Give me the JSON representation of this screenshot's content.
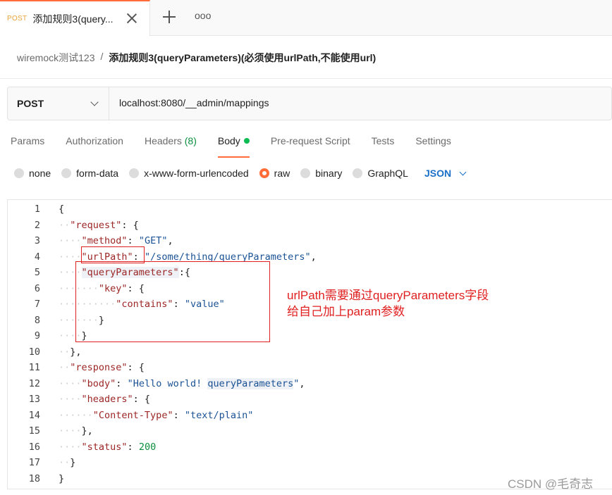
{
  "tab": {
    "method": "POST",
    "title": "添加规则3(query...",
    "more_label": "ooo"
  },
  "breadcrumb": {
    "parent": "wiremock测试123",
    "separator": "/",
    "current": "添加规则3(queryParameters)(必须使用urlPath,不能使用url)"
  },
  "request": {
    "method": "POST",
    "url": "localhost:8080/__admin/mappings"
  },
  "request_tabs": [
    {
      "label": "Params"
    },
    {
      "label": "Authorization"
    },
    {
      "label": "Headers",
      "count": "(8)"
    },
    {
      "label": "Body"
    },
    {
      "label": "Pre-request Script"
    },
    {
      "label": "Tests"
    },
    {
      "label": "Settings"
    }
  ],
  "body_types": [
    {
      "label": "none"
    },
    {
      "label": "form-data"
    },
    {
      "label": "x-www-form-urlencoded"
    },
    {
      "label": "raw",
      "selected": true
    },
    {
      "label": "binary"
    },
    {
      "label": "GraphQL"
    }
  ],
  "body_format": "JSON",
  "editor": {
    "line_numbers": [
      "1",
      "2",
      "3",
      "4",
      "5",
      "6",
      "7",
      "8",
      "9",
      "10",
      "11",
      "12",
      "13",
      "14",
      "15",
      "16",
      "17",
      "18"
    ],
    "lines": [
      {
        "ind": "",
        "parts": [
          {
            "t": "{",
            "c": "punc"
          }
        ]
      },
      {
        "ind": "··",
        "parts": [
          {
            "t": "\"request\"",
            "c": "key"
          },
          {
            "t": ": {",
            "c": "punc"
          }
        ]
      },
      {
        "ind": "····",
        "parts": [
          {
            "t": "\"method\"",
            "c": "key"
          },
          {
            "t": ": ",
            "c": "punc"
          },
          {
            "t": "\"GET\"",
            "c": "str"
          },
          {
            "t": ",",
            "c": "punc"
          }
        ]
      },
      {
        "ind": "····",
        "parts": [
          {
            "t": "\"urlPath\"",
            "c": "key"
          },
          {
            "t": ": ",
            "c": "punc"
          },
          {
            "t": "\"/some/thing/queryParameters\"",
            "c": "str"
          },
          {
            "t": ",",
            "c": "punc"
          }
        ]
      },
      {
        "ind": "····",
        "parts": [
          {
            "t": "\"queryParameters\"",
            "c": "key hl"
          },
          {
            "t": ":{",
            "c": "punc"
          }
        ]
      },
      {
        "ind": "·······",
        "parts": [
          {
            "t": "\"key\"",
            "c": "key"
          },
          {
            "t": ": {",
            "c": "punc"
          }
        ]
      },
      {
        "ind": "··········",
        "parts": [
          {
            "t": "\"contains\"",
            "c": "key"
          },
          {
            "t": ": ",
            "c": "punc"
          },
          {
            "t": "\"value\"",
            "c": "str"
          }
        ]
      },
      {
        "ind": "·······",
        "parts": [
          {
            "t": "}",
            "c": "punc"
          }
        ]
      },
      {
        "ind": "····",
        "parts": [
          {
            "t": "}",
            "c": "punc"
          }
        ]
      },
      {
        "ind": "··",
        "parts": [
          {
            "t": "},",
            "c": "punc"
          }
        ]
      },
      {
        "ind": "··",
        "parts": [
          {
            "t": "\"response\"",
            "c": "key"
          },
          {
            "t": ": {",
            "c": "punc"
          }
        ]
      },
      {
        "ind": "····",
        "parts": [
          {
            "t": "\"body\"",
            "c": "key"
          },
          {
            "t": ": ",
            "c": "punc"
          },
          {
            "t": "\"Hello world! ",
            "c": "str"
          },
          {
            "t": "queryParameters",
            "c": "str hl"
          },
          {
            "t": "\"",
            "c": "str"
          },
          {
            "t": ",",
            "c": "punc"
          }
        ]
      },
      {
        "ind": "····",
        "parts": [
          {
            "t": "\"headers\"",
            "c": "key"
          },
          {
            "t": ": {",
            "c": "punc"
          }
        ]
      },
      {
        "ind": "······",
        "parts": [
          {
            "t": "\"Content-Type\"",
            "c": "key"
          },
          {
            "t": ": ",
            "c": "punc"
          },
          {
            "t": "\"text/plain\"",
            "c": "str"
          }
        ]
      },
      {
        "ind": "····",
        "parts": [
          {
            "t": "},",
            "c": "punc"
          }
        ]
      },
      {
        "ind": "····",
        "parts": [
          {
            "t": "\"status\"",
            "c": "key"
          },
          {
            "t": ": ",
            "c": "punc"
          },
          {
            "t": "200",
            "c": "num"
          }
        ]
      },
      {
        "ind": "··",
        "parts": [
          {
            "t": "}",
            "c": "punc"
          }
        ]
      },
      {
        "ind": "",
        "parts": [
          {
            "t": "}",
            "c": "punc"
          }
        ]
      }
    ]
  },
  "annotation": {
    "line1": "urlPath需要通过queryParameters字段",
    "line2": "给自己加上param参数"
  },
  "watermark": "CSDN @毛奇志",
  "colors": {
    "accent": "#ff6c37",
    "active_dot": "#0cbb52",
    "annotation": "#e02020",
    "json_key": "#9c2626",
    "json_string": "#1a5294"
  }
}
